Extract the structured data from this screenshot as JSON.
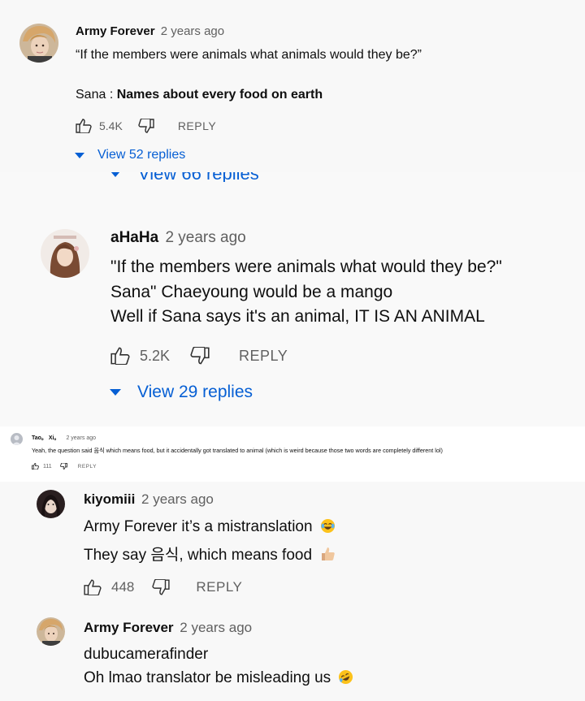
{
  "comment1": {
    "author": "Army Forever",
    "time": "2 years ago",
    "line1": "“If the members were animals what animals would they be?”",
    "line2_prefix": "Sana : ",
    "line2_bold": "Names about every food on earth",
    "likes": "5.4K",
    "reply": "REPLY",
    "view_replies": "View 52 replies"
  },
  "cropped_view_replies": "View 66 replies",
  "comment2": {
    "author": "aHaHa",
    "time": "2 years ago",
    "line1": "\"If the members were animals what would they be?\"",
    "line2": "Sana\" Chaeyoung would be a mango",
    "line3": "Well if Sana says it's an animal, IT IS AN ANIMAL",
    "likes": "5.2K",
    "reply": "REPLY",
    "view_replies": "View 29 replies"
  },
  "comment3": {
    "author": "Tao。 Xi。",
    "time": "2 years ago",
    "text": "Yeah, the question said 음식 which means food, but it accidentally got translated to animal (which is weird because those two words are completely different lol)",
    "likes": "111",
    "reply": "REPLY"
  },
  "comment4": {
    "author": "kiyomiii",
    "time": "2 years ago",
    "line1": "Army Forever it’s a mistranslation",
    "line2": "They say 음식, which means food",
    "likes": "448",
    "reply": "REPLY"
  },
  "comment5": {
    "author": "Army Forever",
    "time": "2 years ago",
    "line1": "dubucamerafinder",
    "line2": "Oh lmao translator be misleading us"
  },
  "icons": {
    "like": "thumbs-up-icon",
    "dislike": "thumbs-down-icon",
    "expand": "triangle-down-icon",
    "emoji_laugh": "tears-of-joy-emoji",
    "emoji_thumb": "thumbs-up-emoji",
    "emoji_rofl": "rolling-laughing-emoji"
  },
  "colors": {
    "link": "#065fd4",
    "secondary": "#606060",
    "text": "#0f0f0f"
  }
}
